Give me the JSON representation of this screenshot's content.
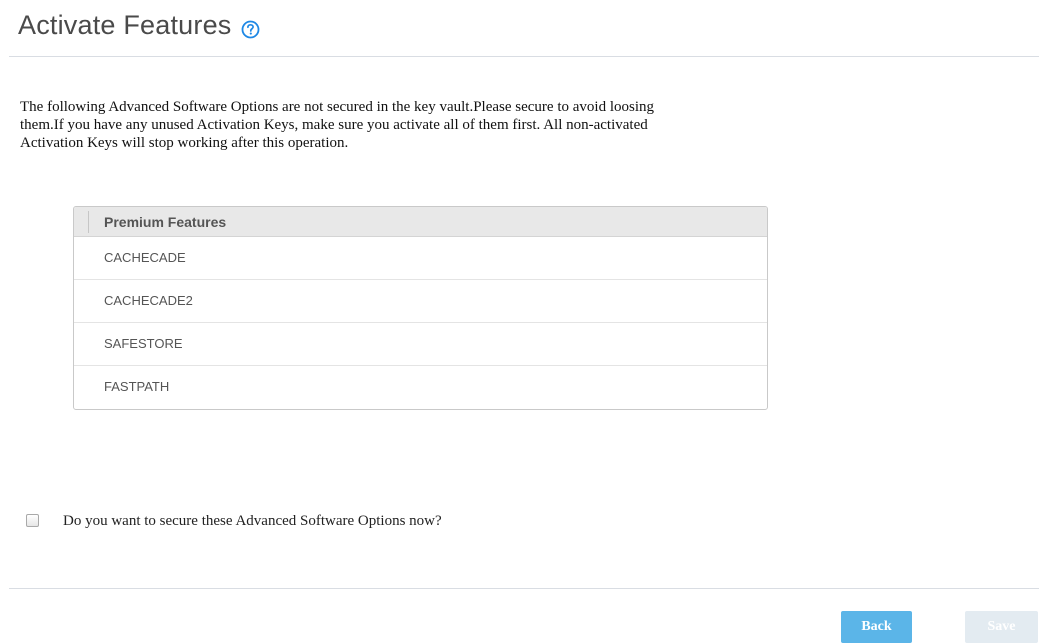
{
  "page": {
    "title": "Activate Features",
    "help_icon": "question-circle-icon"
  },
  "intro": {
    "text": "The following Advanced Software Options are not secured in the key vault.Please secure to avoid loosing them.If you have any unused Activation Keys, make sure you activate all of them first. All non-activated Activation Keys will stop working after this operation."
  },
  "table": {
    "header": "Premium Features",
    "rows": [
      "CACHECADE",
      "CACHECADE2",
      "SAFESTORE",
      "FASTPATH"
    ]
  },
  "confirm": {
    "label": "Do you want to secure these Advanced Software Options now?",
    "checked": false
  },
  "buttons": {
    "back": "Back",
    "save": "Save"
  },
  "colors": {
    "accent": "#5bb5e8",
    "disabled_button": "#e3ebf1",
    "help_icon": "#1e88e5"
  }
}
